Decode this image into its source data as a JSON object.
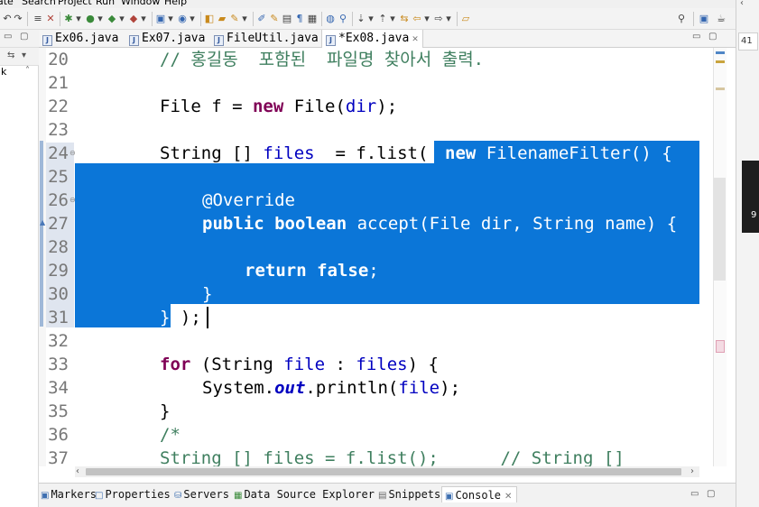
{
  "menu": {
    "items": [
      "ate",
      "Search",
      "Project",
      "Run",
      "Window",
      "Help"
    ]
  },
  "toolbar": {
    "quick_access_icon": "search-icon"
  },
  "left_panel": {
    "fragment_letter": "k"
  },
  "tabs": [
    {
      "label": "Ex06.java",
      "dirty": false,
      "active": false
    },
    {
      "label": "Ex07.java",
      "dirty": false,
      "active": false
    },
    {
      "label": "FileUtil.java",
      "dirty": false,
      "active": false
    },
    {
      "label": "*Ex08.java",
      "dirty": true,
      "active": true
    }
  ],
  "editor": {
    "lines": [
      {
        "number": "20",
        "fold": ""
      },
      {
        "number": "21",
        "fold": ""
      },
      {
        "number": "22",
        "fold": ""
      },
      {
        "number": "23",
        "fold": ""
      },
      {
        "number": "24",
        "fold": "collapse"
      },
      {
        "number": "25",
        "fold": ""
      },
      {
        "number": "26",
        "fold": "collapse"
      },
      {
        "number": "27",
        "fold": ""
      },
      {
        "number": "28",
        "fold": ""
      },
      {
        "number": "29",
        "fold": ""
      },
      {
        "number": "30",
        "fold": ""
      },
      {
        "number": "31",
        "fold": ""
      },
      {
        "number": "32",
        "fold": ""
      },
      {
        "number": "33",
        "fold": ""
      },
      {
        "number": "34",
        "fold": ""
      },
      {
        "number": "35",
        "fold": ""
      },
      {
        "number": "36",
        "fold": ""
      },
      {
        "number": "37",
        "fold": ""
      }
    ],
    "code": {
      "l20": "// 홍길동  포함된  파일명 찾아서 출력.",
      "l22_kw": "new",
      "l22_a": "File f = ",
      "l22_b": " File(",
      "l22_c": "dir",
      "l22_d": ");",
      "l24_a": "String [] ",
      "l24_b": "files",
      "l24_c": "  = f.list(",
      "l24_sel_kw": "new",
      "l24_sel": " FilenameFilter() {",
      "l26_ann": "@Override",
      "l27_kw1": "public",
      "l27_kw2": "boolean",
      "l27_rest": " accept(File dir, String name) {",
      "l29_kw1": "return",
      "l29_kw2": "false",
      "l29_end": ";",
      "l30": "}",
      "l31_brace": "}",
      "l31_rest": " );",
      "l33_kw": "for",
      "l33_a": " (String ",
      "l33_b": "file",
      "l33_c": " : ",
      "l33_d": "files",
      "l33_e": ") {",
      "l34_a": "System.",
      "l34_b": "out",
      "l34_c": ".println(",
      "l34_d": "file",
      "l34_e": ");",
      "l35": "}",
      "l36": "/*",
      "l37": "String [] files = f.list();      // String []"
    }
  },
  "bottom_tabs": [
    {
      "label": "Markers",
      "icon": "markers-icon",
      "active": false
    },
    {
      "label": "Properties",
      "icon": "properties-icon",
      "active": false
    },
    {
      "label": "Servers",
      "icon": "servers-icon",
      "active": false
    },
    {
      "label": "Data Source Explorer",
      "icon": "database-icon",
      "active": false
    },
    {
      "label": "Snippets",
      "icon": "snippets-icon",
      "active": false
    },
    {
      "label": "Console",
      "icon": "console-icon",
      "active": true
    }
  ],
  "right_strip": {
    "fragment_a": "41",
    "fragment_b": "9"
  },
  "colors": {
    "selection": "#0b76d8",
    "keyword": "#7f0055",
    "comment": "#3f7f5f",
    "field": "#0000c0",
    "annotation": "#646464",
    "line_number": "#787878"
  }
}
